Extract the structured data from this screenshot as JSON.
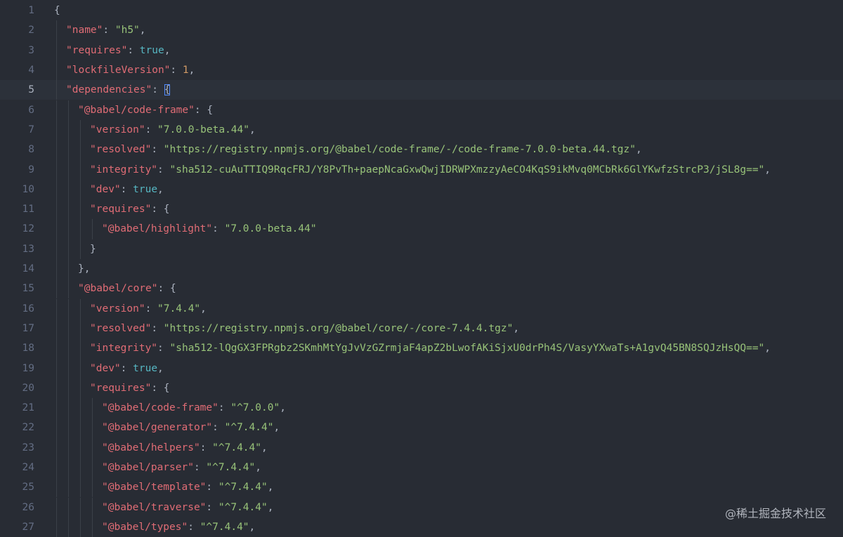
{
  "editor": {
    "current_line": 5,
    "lines": [
      {
        "n": "1",
        "indent": 0,
        "parts": [
          [
            "punc",
            "{"
          ]
        ]
      },
      {
        "n": "2",
        "indent": 1,
        "parts": [
          [
            "key",
            "\"name\""
          ],
          [
            "punc",
            ": "
          ],
          [
            "str",
            "\"h5\""
          ],
          [
            "punc",
            ","
          ]
        ]
      },
      {
        "n": "3",
        "indent": 1,
        "parts": [
          [
            "key",
            "\"requires\""
          ],
          [
            "punc",
            ": "
          ],
          [
            "bool",
            "true"
          ],
          [
            "punc",
            ","
          ]
        ]
      },
      {
        "n": "4",
        "indent": 1,
        "parts": [
          [
            "key",
            "\"lockfileVersion\""
          ],
          [
            "punc",
            ": "
          ],
          [
            "num",
            "1"
          ],
          [
            "punc",
            ","
          ]
        ]
      },
      {
        "n": "5",
        "indent": 1,
        "parts": [
          [
            "key",
            "\"dependencies\""
          ],
          [
            "punc",
            ": "
          ],
          [
            "punc-match",
            "{"
          ]
        ]
      },
      {
        "n": "6",
        "indent": 2,
        "parts": [
          [
            "key",
            "\"@babel/code-frame\""
          ],
          [
            "punc",
            ": {"
          ]
        ]
      },
      {
        "n": "7",
        "indent": 3,
        "parts": [
          [
            "key",
            "\"version\""
          ],
          [
            "punc",
            ": "
          ],
          [
            "str",
            "\"7.0.0-beta.44\""
          ],
          [
            "punc",
            ","
          ]
        ]
      },
      {
        "n": "8",
        "indent": 3,
        "parts": [
          [
            "key",
            "\"resolved\""
          ],
          [
            "punc",
            ": "
          ],
          [
            "str",
            "\"https://registry.npmjs.org/@babel/code-frame/-/code-frame-7.0.0-beta.44.tgz\""
          ],
          [
            "punc",
            ","
          ]
        ]
      },
      {
        "n": "9",
        "indent": 3,
        "parts": [
          [
            "key",
            "\"integrity\""
          ],
          [
            "punc",
            ": "
          ],
          [
            "str",
            "\"sha512-cuAuTTIQ9RqcFRJ/Y8PvTh+paepNcaGxwQwjIDRWPXmzzyAeCO4KqS9ikMvq0MCbRk6GlYKwfzStrcP3/jSL8g==\""
          ],
          [
            "punc",
            ","
          ]
        ]
      },
      {
        "n": "10",
        "indent": 3,
        "parts": [
          [
            "key",
            "\"dev\""
          ],
          [
            "punc",
            ": "
          ],
          [
            "bool",
            "true"
          ],
          [
            "punc",
            ","
          ]
        ]
      },
      {
        "n": "11",
        "indent": 3,
        "parts": [
          [
            "key",
            "\"requires\""
          ],
          [
            "punc",
            ": {"
          ]
        ]
      },
      {
        "n": "12",
        "indent": 4,
        "parts": [
          [
            "key",
            "\"@babel/highlight\""
          ],
          [
            "punc",
            ": "
          ],
          [
            "str",
            "\"7.0.0-beta.44\""
          ]
        ]
      },
      {
        "n": "13",
        "indent": 3,
        "parts": [
          [
            "punc",
            "}"
          ]
        ]
      },
      {
        "n": "14",
        "indent": 2,
        "parts": [
          [
            "punc",
            "},"
          ]
        ]
      },
      {
        "n": "15",
        "indent": 2,
        "parts": [
          [
            "key",
            "\"@babel/core\""
          ],
          [
            "punc",
            ": {"
          ]
        ]
      },
      {
        "n": "16",
        "indent": 3,
        "parts": [
          [
            "key",
            "\"version\""
          ],
          [
            "punc",
            ": "
          ],
          [
            "str",
            "\"7.4.4\""
          ],
          [
            "punc",
            ","
          ]
        ]
      },
      {
        "n": "17",
        "indent": 3,
        "parts": [
          [
            "key",
            "\"resolved\""
          ],
          [
            "punc",
            ": "
          ],
          [
            "str",
            "\"https://registry.npmjs.org/@babel/core/-/core-7.4.4.tgz\""
          ],
          [
            "punc",
            ","
          ]
        ]
      },
      {
        "n": "18",
        "indent": 3,
        "parts": [
          [
            "key",
            "\"integrity\""
          ],
          [
            "punc",
            ": "
          ],
          [
            "str",
            "\"sha512-lQgGX3FPRgbz2SKmhMtYgJvVzGZrmjaF4apZ2bLwofAKiSjxU0drPh4S/VasyYXwaTs+A1gvQ45BN8SQJzHsQQ==\""
          ],
          [
            "punc",
            ","
          ]
        ]
      },
      {
        "n": "19",
        "indent": 3,
        "parts": [
          [
            "key",
            "\"dev\""
          ],
          [
            "punc",
            ": "
          ],
          [
            "bool",
            "true"
          ],
          [
            "punc",
            ","
          ]
        ]
      },
      {
        "n": "20",
        "indent": 3,
        "parts": [
          [
            "key",
            "\"requires\""
          ],
          [
            "punc",
            ": {"
          ]
        ]
      },
      {
        "n": "21",
        "indent": 4,
        "parts": [
          [
            "key",
            "\"@babel/code-frame\""
          ],
          [
            "punc",
            ": "
          ],
          [
            "str",
            "\"^7.0.0\""
          ],
          [
            "punc",
            ","
          ]
        ]
      },
      {
        "n": "22",
        "indent": 4,
        "parts": [
          [
            "key",
            "\"@babel/generator\""
          ],
          [
            "punc",
            ": "
          ],
          [
            "str",
            "\"^7.4.4\""
          ],
          [
            "punc",
            ","
          ]
        ]
      },
      {
        "n": "23",
        "indent": 4,
        "parts": [
          [
            "key",
            "\"@babel/helpers\""
          ],
          [
            "punc",
            ": "
          ],
          [
            "str",
            "\"^7.4.4\""
          ],
          [
            "punc",
            ","
          ]
        ]
      },
      {
        "n": "24",
        "indent": 4,
        "parts": [
          [
            "key",
            "\"@babel/parser\""
          ],
          [
            "punc",
            ": "
          ],
          [
            "str",
            "\"^7.4.4\""
          ],
          [
            "punc",
            ","
          ]
        ]
      },
      {
        "n": "25",
        "indent": 4,
        "parts": [
          [
            "key",
            "\"@babel/template\""
          ],
          [
            "punc",
            ": "
          ],
          [
            "str",
            "\"^7.4.4\""
          ],
          [
            "punc",
            ","
          ]
        ]
      },
      {
        "n": "26",
        "indent": 4,
        "parts": [
          [
            "key",
            "\"@babel/traverse\""
          ],
          [
            "punc",
            ": "
          ],
          [
            "str",
            "\"^7.4.4\""
          ],
          [
            "punc",
            ","
          ]
        ]
      },
      {
        "n": "27",
        "indent": 4,
        "parts": [
          [
            "key",
            "\"@babel/types\""
          ],
          [
            "punc",
            ": "
          ],
          [
            "str",
            "\"^7.4.4\""
          ],
          [
            "punc",
            ","
          ]
        ]
      }
    ]
  },
  "watermark": "@稀土掘金技术社区",
  "colors": {
    "background": "#282c34",
    "key": "#e06c75",
    "string": "#98c379",
    "boolean": "#56b6c2",
    "number": "#d19a66"
  }
}
